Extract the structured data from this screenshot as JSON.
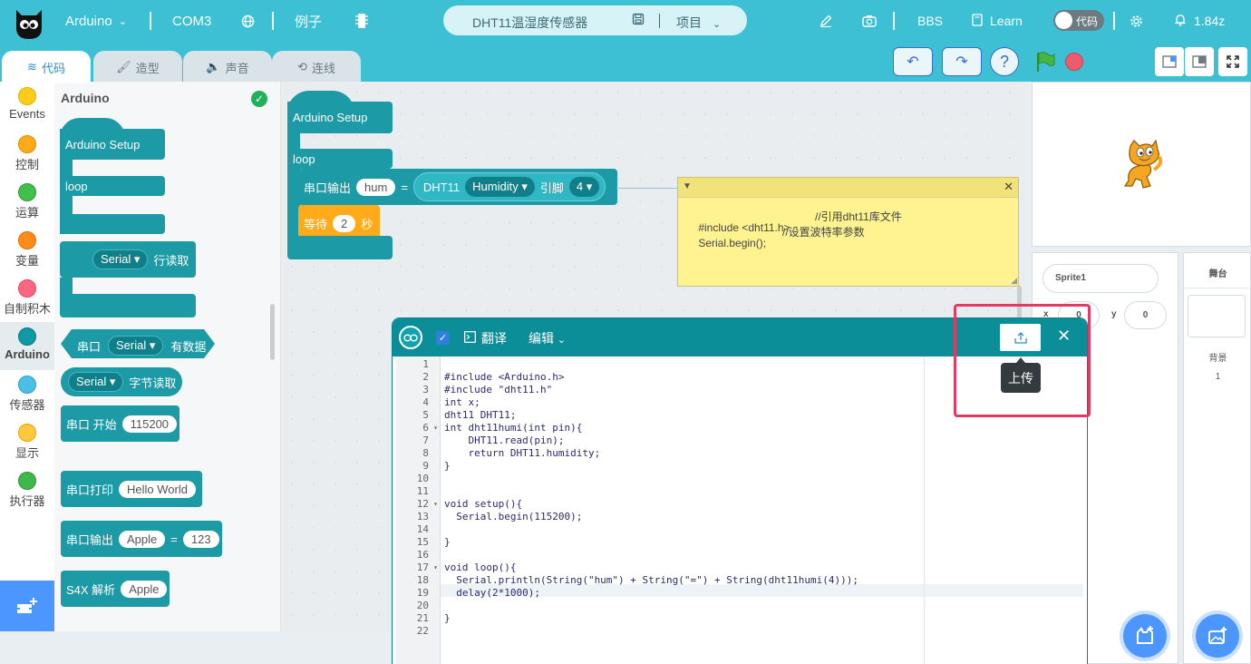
{
  "topbar": {
    "board": "Arduino",
    "port": "COM3",
    "examples": "例子",
    "project_name": "DHT11温湿度传感器",
    "project_menu": "项目",
    "bbs": "BBS",
    "learn": "Learn",
    "code_toggle": "代码",
    "version": "1.84z"
  },
  "tabs": [
    {
      "label": "代码"
    },
    {
      "label": "造型"
    },
    {
      "label": "声音"
    },
    {
      "label": "连线"
    }
  ],
  "categories": [
    {
      "label": "Events",
      "color": "#ffcc1a"
    },
    {
      "label": "控制",
      "color": "#ffab19"
    },
    {
      "label": "运算",
      "color": "#40bf4a"
    },
    {
      "label": "变量",
      "color": "#ff8c1a"
    },
    {
      "label": "自制积木",
      "color": "#ff6680"
    },
    {
      "label": "Arduino",
      "color": "#0f9aa3"
    },
    {
      "label": "传感器",
      "color": "#4cbfe6"
    },
    {
      "label": "显示",
      "color": "#ffc83d"
    },
    {
      "label": "执行器",
      "color": "#3fb84a"
    }
  ],
  "flyout": {
    "title": "Arduino",
    "setup": "Arduino Setup",
    "loop": "loop",
    "serial_readline": {
      "dropdown": "Serial",
      "text": "行读取"
    },
    "serial_available": {
      "prefix": "串口",
      "dropdown": "Serial",
      "suffix": "有数据"
    },
    "serial_readbyte": {
      "dropdown": "Serial",
      "text": "字节读取"
    },
    "serial_begin": {
      "text": "串口 开始",
      "value": "115200"
    },
    "serial_print": {
      "text": "串口打印",
      "value": "Hello World"
    },
    "serial_output": {
      "text": "串口输出",
      "key": "Apple",
      "eq": "=",
      "value": "123"
    },
    "s4x_parse": {
      "text": "S4X 解析",
      "value": "Apple"
    }
  },
  "workspace": {
    "setup": "Arduino Setup",
    "loop": "loop",
    "serial_out_label": "串口输出",
    "serial_out_key": "hum",
    "eq": "=",
    "dht_label": "DHT11",
    "dht_field": "Humidity",
    "pin_label": "引脚",
    "pin_value": "4",
    "wait_label": "等待",
    "wait_value": "2",
    "wait_unit": "秒"
  },
  "note": {
    "lines": [
      {
        "code": "#include <dht11.h>",
        "comment": "//引用dht11库文件"
      },
      {
        "code": "Serial.begin();",
        "comment": "//设置波特率参数"
      }
    ]
  },
  "stage_panel": {
    "sprite_name": "Sprite1",
    "x_label": "x",
    "x_value": "0",
    "y_label": "y",
    "y_value": "0",
    "stage_title": "舞台",
    "backdrop_label": "背景",
    "backdrop_count": "1"
  },
  "dialog": {
    "translate": "翻译",
    "edit": "编辑",
    "upload_tooltip": "上传",
    "line_numbers": [
      "1",
      "2",
      "3",
      "4",
      "5",
      "6",
      "7",
      "8",
      "9",
      "10",
      "11",
      "12",
      "13",
      "14",
      "15",
      "16",
      "17",
      "18",
      "19",
      "20",
      "21",
      "22"
    ],
    "lines": [
      "",
      "#include <Arduino.h>",
      "#include \"dht11.h\"",
      "int x;",
      "dht11 DHT11;",
      "int dht11humi(int pin){",
      "    DHT11.read(pin);",
      "    return DHT11.humidity;",
      "}",
      "",
      "",
      "void setup(){",
      "  Serial.begin(115200);",
      "",
      "}",
      "",
      "void loop(){",
      "  Serial.println(String(\"hum\") + String(\"=\") + String(dht11humi(4)));",
      "  delay(2*1000);",
      "",
      "}",
      ""
    ]
  }
}
